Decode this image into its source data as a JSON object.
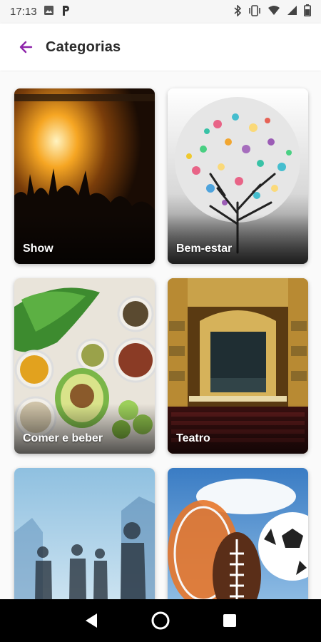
{
  "status_bar": {
    "time": "17:13",
    "left_icons": [
      "image-icon",
      "p-app-icon"
    ],
    "right_icons": [
      "bluetooth-icon",
      "vibrate-icon",
      "wifi-icon",
      "signal-icon",
      "battery-icon"
    ]
  },
  "header": {
    "title": "Categorias",
    "back_icon": "arrow-left-icon",
    "accent_color": "#8e24aa"
  },
  "categories": [
    {
      "label": "Show"
    },
    {
      "label": "Bem-estar"
    },
    {
      "label": "Comer e beber"
    },
    {
      "label": "Teatro"
    },
    {
      "label": ""
    },
    {
      "label": ""
    }
  ],
  "nav_bar": {
    "buttons": [
      "back-triangle-icon",
      "home-circle-icon",
      "recents-square-icon"
    ]
  }
}
